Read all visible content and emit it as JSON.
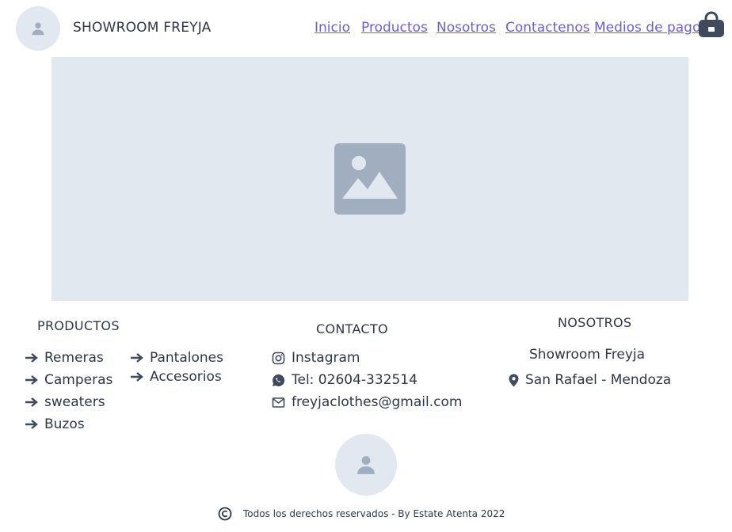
{
  "header": {
    "brand": "SHOWROOM FREYJA",
    "nav": [
      "Inicio",
      "Productos",
      "Nosotros",
      "Contactenos",
      "Medios de pago"
    ]
  },
  "footer": {
    "productos": {
      "title": "PRODUCTOS",
      "col1": [
        "Remeras",
        "Camperas",
        "sweaters",
        "Buzos"
      ],
      "col2": [
        "Pantalones",
        "Accesorios"
      ]
    },
    "contacto": {
      "title": "CONTACTO",
      "instagram": "Instagram",
      "phone": "Tel: 02604-332514",
      "email": "freyjaclothes@gmail.com"
    },
    "nosotros": {
      "title": "NOSOTROS",
      "name": "Showroom Freyja",
      "location": "San Rafael - Mendoza"
    },
    "copyright": "Todos los derechos reservados - By Estate Atenta 2022"
  },
  "colors": {
    "link": "#6b5fd8",
    "placeholder_bg": "#e2e8f0",
    "icon_gray": "#a0aec0",
    "cart": "#3f4a5c"
  }
}
